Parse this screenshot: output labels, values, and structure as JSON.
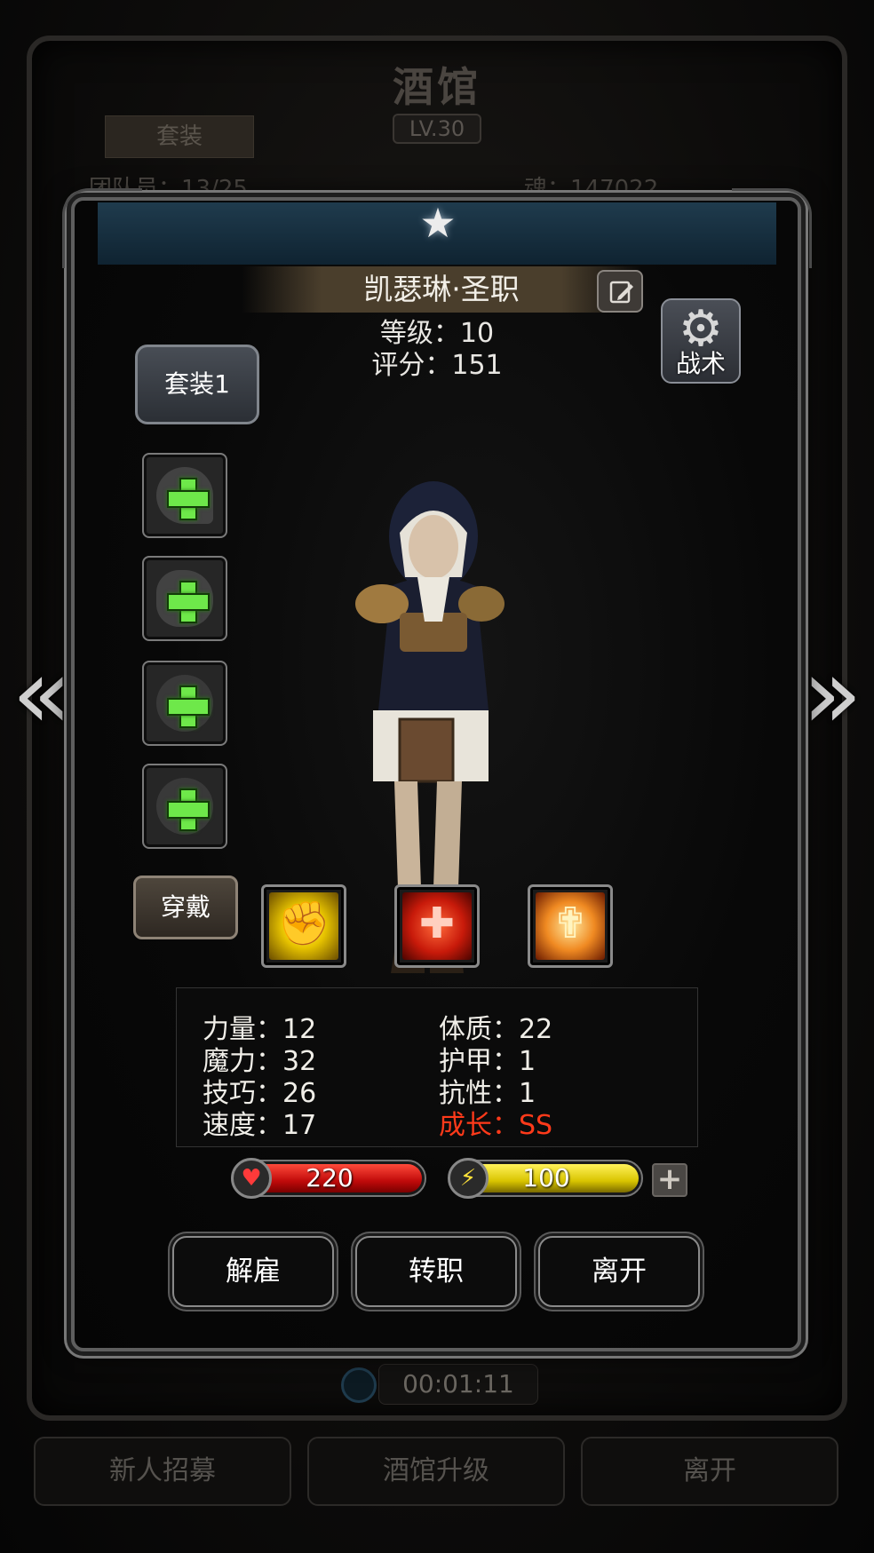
{
  "background": {
    "title": "酒馆",
    "level": "LV.30",
    "tab_label": "套装",
    "hero_count": "团队员：13/25",
    "soul": "魂：147022",
    "timer": "00:01:11",
    "buttons": [
      "新人招募",
      "酒馆升级",
      "离开"
    ]
  },
  "hero": {
    "name": "凯瑟琳·圣职",
    "level": "等级：10",
    "score": "评分：151"
  },
  "controls": {
    "tactics_label": "战术",
    "set_label": "套装1",
    "wear_label": "穿戴"
  },
  "equipment_slots": [
    {
      "type": "weapon"
    },
    {
      "type": "armor"
    },
    {
      "type": "accessory"
    },
    {
      "type": "accessory"
    }
  ],
  "skills": [
    {
      "icon": "fist-icon",
      "color": "#e8c400"
    },
    {
      "icon": "cross-icon",
      "color": "#c81a0a"
    },
    {
      "icon": "shield-cross-icon",
      "color": "#f08a22"
    }
  ],
  "stats": {
    "left": [
      "力量：12",
      "魔力：32",
      "技巧：26",
      "速度：17"
    ],
    "right": [
      "体质：22",
      "护甲：1",
      "抗性：1"
    ],
    "growth": "成长：SS"
  },
  "bars": {
    "hp": {
      "value": "220",
      "fill": 1.0,
      "color": "#c00a0a",
      "icon": "heart-icon"
    },
    "energy": {
      "value": "100",
      "fill": 1.0,
      "color": "#d8c400",
      "icon": "lightning-icon"
    },
    "plus": "+"
  },
  "actions": {
    "dismiss": "解雇",
    "transfer": "转职",
    "leave": "离开"
  },
  "nav": {
    "prev": "«",
    "next": "»"
  }
}
